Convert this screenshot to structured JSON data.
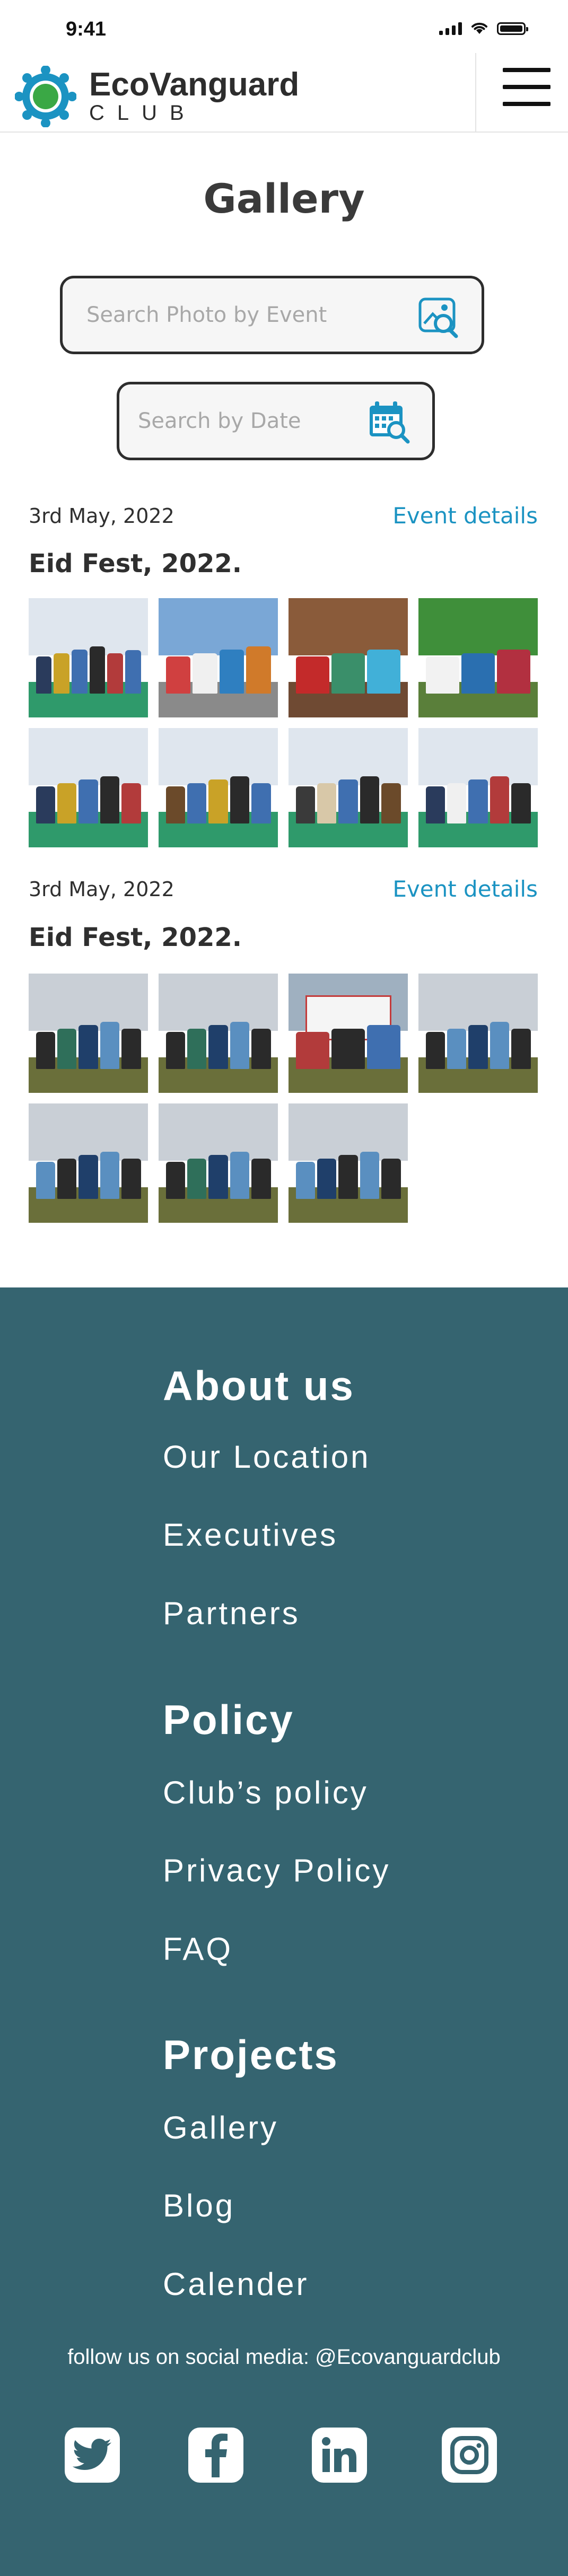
{
  "status_bar": {
    "time": "9:41"
  },
  "header": {
    "brand_name": "EcoVanguard",
    "brand_sub": "CLUB",
    "brand_color": "#1b93c2",
    "brand_accent": "#3aa845"
  },
  "page": {
    "title": "Gallery"
  },
  "search": {
    "event_placeholder": "Search Photo by Event",
    "date_placeholder": "Search by Date"
  },
  "events": [
    {
      "date": "3rd May, 2022",
      "details_label": "Event details",
      "title": "Eid Fest, 2022.",
      "photo_count": 8
    },
    {
      "date": "3rd May, 2022",
      "details_label": "Event details",
      "title": "Eid Fest, 2022.",
      "photo_count": 7
    }
  ],
  "footer": {
    "background": "#356470",
    "sections": [
      {
        "heading": "About us",
        "links": [
          "Our Location",
          "Executives",
          "Partners"
        ]
      },
      {
        "heading": "Policy",
        "links": [
          "Club’s policy",
          "Privacy Policy",
          "FAQ"
        ]
      },
      {
        "heading": "Projects",
        "links": [
          "Gallery",
          "Blog",
          "Calender"
        ]
      }
    ],
    "social_text": "follow us on social media: @Ecovanguardclub",
    "social_icons": [
      "twitter-icon",
      "facebook-icon",
      "linkedin-icon",
      "instagram-icon"
    ]
  }
}
